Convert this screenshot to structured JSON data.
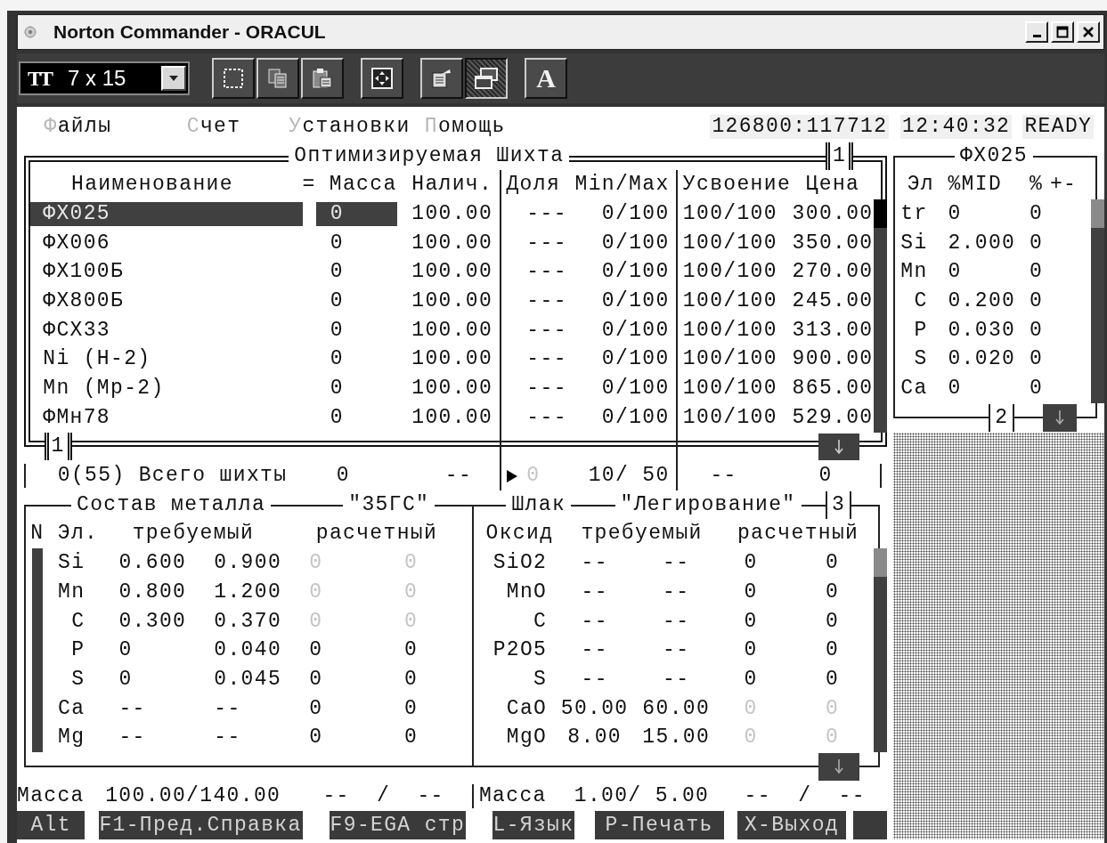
{
  "window": {
    "title": "Norton Commander - ORACUL"
  },
  "toolbar": {
    "font_icon": "TT",
    "font_size": "7 x 15",
    "groups": [
      [
        {
          "kind": "mark",
          "pressed": false
        },
        {
          "kind": "copy",
          "pressed": false
        },
        {
          "kind": "paste",
          "pressed": false
        }
      ],
      [
        {
          "kind": "fullscreen",
          "pressed": false
        }
      ],
      [
        {
          "kind": "properties",
          "pressed": false
        },
        {
          "kind": "background",
          "pressed": true
        }
      ],
      [
        {
          "kind": "font",
          "label": "A",
          "pressed": false
        }
      ]
    ]
  },
  "menu": [
    {
      "label": "Файлы"
    },
    {
      "label": "Счет"
    },
    {
      "label": "Установки"
    },
    {
      "label": "Помощь"
    }
  ],
  "status": {
    "memory": "126800:117712",
    "time": "12:40:32",
    "state": "READY"
  },
  "charge_table": {
    "title": "Оптимизируемая Шихта",
    "top_tab": "1",
    "bottom_tab": "1",
    "columns": [
      "Наименование",
      "= Масса",
      "Налич.",
      "Доля",
      "Min/Max",
      "Усвоение",
      "Цена"
    ],
    "rows": [
      {
        "name": "ФХ025",
        "mass": "0",
        "available": "100.00",
        "share": "---",
        "min_max": "0/100",
        "assimilation": "100/100",
        "price": "300.00",
        "selected": true
      },
      {
        "name": "ФХ006",
        "mass": "0",
        "available": "100.00",
        "share": "---",
        "min_max": "0/100",
        "assimilation": "100/100",
        "price": "350.00",
        "selected": false
      },
      {
        "name": "ФХ100Б",
        "mass": "0",
        "available": "100.00",
        "share": "---",
        "min_max": "0/100",
        "assimilation": "100/100",
        "price": "270.00",
        "selected": false
      },
      {
        "name": "ФХ800Б",
        "mass": "0",
        "available": "100.00",
        "share": "---",
        "min_max": "0/100",
        "assimilation": "100/100",
        "price": "245.00",
        "selected": false
      },
      {
        "name": "ФСХ33",
        "mass": "0",
        "available": "100.00",
        "share": "---",
        "min_max": "0/100",
        "assimilation": "100/100",
        "price": "313.00",
        "selected": false
      },
      {
        "name": "Ni (H-2)",
        "mass": "0",
        "available": "100.00",
        "share": "---",
        "min_max": "0/100",
        "assimilation": "100/100",
        "price": "900.00",
        "selected": false
      },
      {
        "name": "Mn (Mp-2)",
        "mass": "0",
        "available": "100.00",
        "share": "---",
        "min_max": "0/100",
        "assimilation": "100/100",
        "price": "865.00",
        "selected": false
      },
      {
        "name": "ФМн78",
        "mass": "0",
        "available": "100.00",
        "share": "---",
        "min_max": "0/100",
        "assimilation": "100/100",
        "price": "529.00",
        "selected": false
      }
    ]
  },
  "totals": {
    "label": "0(55) Всего шихты",
    "mass": "0",
    "available": "--",
    "share": "0",
    "share_dimmed": true,
    "min_max": "10/ 50",
    "assimilation": "--",
    "price": "0"
  },
  "element_panel": {
    "title": "ФХ025",
    "tab": "2",
    "columns": [
      "Эл",
      "%MID",
      "%",
      "+-"
    ],
    "rows": [
      {
        "element": "tr",
        "mid": "0",
        "percent": "0"
      },
      {
        "element": "Si",
        "mid": "2.000",
        "percent": "0"
      },
      {
        "element": "Mn",
        "mid": "0",
        "percent": "0"
      },
      {
        "element": "C",
        "mid": "0.200",
        "percent": "0"
      },
      {
        "element": "P",
        "mid": "0.030",
        "percent": "0"
      },
      {
        "element": "S",
        "mid": "0.020",
        "percent": "0"
      },
      {
        "element": "Ca",
        "mid": "0",
        "percent": "0"
      }
    ]
  },
  "metal": {
    "title": "Состав металла",
    "grade": "\"35ГС\"",
    "columns": [
      "N",
      "Эл.",
      "требуемый",
      "расчетный"
    ],
    "rows": [
      {
        "element": "Si",
        "min": "0.600",
        "max": "0.900",
        "calc_1": "0",
        "calc_2": "0",
        "dimmed": true
      },
      {
        "element": "Mn",
        "min": "0.800",
        "max": "1.200",
        "calc_1": "0",
        "calc_2": "0",
        "dimmed": true
      },
      {
        "element": "C",
        "min": "0.300",
        "max": "0.370",
        "calc_1": "0",
        "calc_2": "0",
        "dimmed": true
      },
      {
        "element": "P",
        "min": "0",
        "max": "0.040",
        "calc_1": "0",
        "calc_2": "0",
        "dimmed": false
      },
      {
        "element": "S",
        "min": "0",
        "max": "0.045",
        "calc_1": "0",
        "calc_2": "0",
        "dimmed": false
      },
      {
        "element": "Ca",
        "min": "--",
        "max": "--",
        "calc_1": "0",
        "calc_2": "0",
        "dimmed": false
      },
      {
        "element": "Mg",
        "min": "--",
        "max": "--",
        "calc_1": "0",
        "calc_2": "0",
        "dimmed": false
      }
    ],
    "mass_label": "Масса",
    "mass": "100.00/140.00",
    "mass_range": "--  /  --"
  },
  "slag": {
    "title": "Шлак",
    "mode": "\"Легирование\"",
    "tab": "3",
    "columns": [
      "Оксид",
      "требуемый",
      "расчетный"
    ],
    "rows": [
      {
        "oxide": "SiO2",
        "min": "--",
        "max": "--",
        "calc_1": "0",
        "calc_2": "0",
        "dimmed": false
      },
      {
        "oxide": "MnO",
        "min": "--",
        "max": "--",
        "calc_1": "0",
        "calc_2": "0",
        "dimmed": false
      },
      {
        "oxide": "C",
        "min": "--",
        "max": "--",
        "calc_1": "0",
        "calc_2": "0",
        "dimmed": false
      },
      {
        "oxide": "P2O5",
        "min": "--",
        "max": "--",
        "calc_1": "0",
        "calc_2": "0",
        "dimmed": false
      },
      {
        "oxide": "S",
        "min": "--",
        "max": "--",
        "calc_1": "0",
        "calc_2": "0",
        "dimmed": false
      },
      {
        "oxide": "CaO",
        "min": "50.00",
        "max": "60.00",
        "calc_1": "0",
        "calc_2": "0",
        "dimmed": true
      },
      {
        "oxide": "MgO",
        "min": "8.00",
        "max": "15.00",
        "calc_1": "0",
        "calc_2": "0",
        "dimmed": true
      }
    ],
    "mass_label": "Масса",
    "mass": "1.00/ 5.00",
    "mass_range": "--  /  --"
  },
  "function_keys": [
    {
      "label": "Alt"
    },
    {
      "label": "F1-Пред.Справка"
    },
    {
      "label": "F9-EGA стр"
    },
    {
      "label": "L-Язык"
    },
    {
      "label": "P-Печать"
    },
    {
      "label": "X-Выход"
    }
  ]
}
